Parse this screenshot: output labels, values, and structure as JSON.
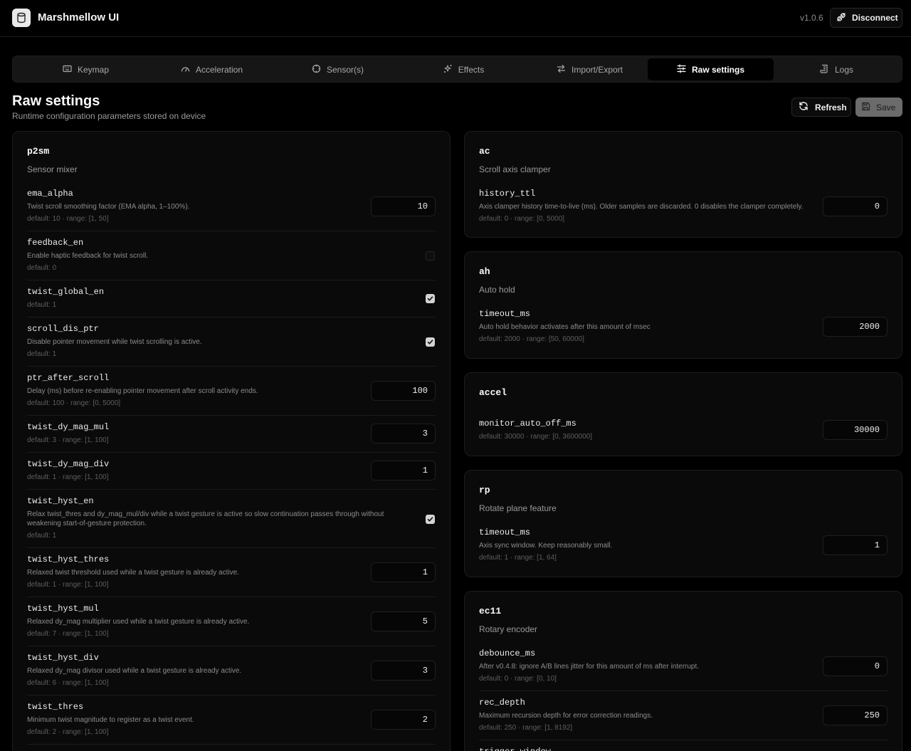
{
  "app": {
    "title": "Marshmellow UI",
    "version": "v1.0.6",
    "disconnect_label": "Disconnect"
  },
  "tabs": [
    {
      "label": "Keymap",
      "icon": "keyboard-icon",
      "active": false
    },
    {
      "label": "Acceleration",
      "icon": "gauge-icon",
      "active": false
    },
    {
      "label": "Sensor(s)",
      "icon": "crosshair-icon",
      "active": false
    },
    {
      "label": "Effects",
      "icon": "sparkles-icon",
      "active": false
    },
    {
      "label": "Import/Export",
      "icon": "arrows-swap-icon",
      "active": false
    },
    {
      "label": "Raw settings",
      "icon": "sliders-icon",
      "active": true
    },
    {
      "label": "Logs",
      "icon": "scroll-icon",
      "active": false
    }
  ],
  "page": {
    "title": "Raw settings",
    "subtitle": "Runtime configuration parameters stored on device",
    "refresh_label": "Refresh",
    "save_label": "Save"
  },
  "left": {
    "p2sm": {
      "key": "p2sm",
      "desc": "Sensor mixer",
      "params": [
        {
          "name": "ema_alpha",
          "help": "Twist scroll smoothing factor (EMA alpha, 1–100%).",
          "default": "default: 10 · range: [1, 50]",
          "value": "10"
        },
        {
          "name": "feedback_en",
          "help": "Enable haptic feedback for twist scroll.",
          "default": "default: 0",
          "checked": false
        },
        {
          "name": "twist_global_en",
          "help": "",
          "default": "default: 1",
          "checked": true
        },
        {
          "name": "scroll_dis_ptr",
          "help": "Disable pointer movement while twist scrolling is active.",
          "default": "default: 1",
          "checked": true
        },
        {
          "name": "ptr_after_scroll",
          "help": "Delay (ms) before re-enabling pointer movement after scroll activity ends.",
          "default": "default: 100 · range: [0, 5000]",
          "value": "100"
        },
        {
          "name": "twist_dy_mag_mul",
          "help": "",
          "default": "default: 3 · range: [1, 100]",
          "value": "3"
        },
        {
          "name": "twist_dy_mag_div",
          "help": "",
          "default": "default: 1 · range: [1, 100]",
          "value": "1"
        },
        {
          "name": "twist_hyst_en",
          "help": "Relax twist_thres and dy_mag_mul/div while a twist gesture is active so slow continuation passes through without weakening start-of-gesture protection.",
          "default": "default: 1",
          "checked": true
        },
        {
          "name": "twist_hyst_thres",
          "help": "Relaxed twist threshold used while a twist gesture is already active.",
          "default": "default: 1 · range: [1, 100]",
          "value": "1"
        },
        {
          "name": "twist_hyst_mul",
          "help": "Relaxed dy_mag multiplier used while a twist gesture is already active.",
          "default": "default: 7 · range: [1, 100]",
          "value": "5"
        },
        {
          "name": "twist_hyst_div",
          "help": "Relaxed dy_mag divisor used while a twist gesture is already active.",
          "default": "default: 6 · range: [1, 100]",
          "value": "3"
        },
        {
          "name": "twist_thres",
          "help": "Minimum twist magnitude to register as a twist event.",
          "default": "default: 2 · range: [1, 100]",
          "value": "2"
        }
      ]
    }
  },
  "right": {
    "ac": {
      "key": "ac",
      "desc": "Scroll axis clamper",
      "params": [
        {
          "name": "history_ttl",
          "help": "Axis clamper history time-to-live (ms). Older samples are discarded. 0 disables the clamper completely.",
          "default": "default: 0 · range: [0, 5000]",
          "value": "0"
        }
      ]
    },
    "ah": {
      "key": "ah",
      "desc": "Auto hold",
      "params": [
        {
          "name": "timeout_ms",
          "help": "Auto hold behavior activates after this amount of msec",
          "default": "default: 2000 · range: [50, 60000]",
          "value": "2000"
        }
      ]
    },
    "accel": {
      "key": "accel",
      "desc": "",
      "params": [
        {
          "name": "monitor_auto_off_ms",
          "help": "",
          "default": "default: 30000 · range: [0, 3600000]",
          "value": "30000"
        }
      ]
    },
    "rp": {
      "key": "rp",
      "desc": "Rotate plane feature",
      "params": [
        {
          "name": "timeout_ms",
          "help": "Axis sync window. Keep reasonably small.",
          "default": "default: 1 · range: [1, 64]",
          "value": "1"
        }
      ]
    },
    "ec11": {
      "key": "ec11",
      "desc": "Rotary encoder",
      "params": [
        {
          "name": "debounce_ms",
          "help": "After v0.4.8: ignore A/B lines jitter for this amount of ms after interrupt.",
          "default": "default: 0 · range: [0, 10]",
          "value": "0"
        },
        {
          "name": "rec_depth",
          "help": "Maximum recursion depth for error correction readings.",
          "default": "default: 250 · range: [1, 8192]",
          "value": "250"
        },
        {
          "name": "trigger_window",
          "help": "",
          "default": "",
          "value": ""
        }
      ]
    }
  },
  "colors": {
    "background": "#000000",
    "card": "#0a0a0a",
    "border": "#1c1c1c",
    "muted": "#8c8c8c",
    "checkbox_on": "#d4d4d4",
    "save_disabled": "#6b6b6b"
  }
}
